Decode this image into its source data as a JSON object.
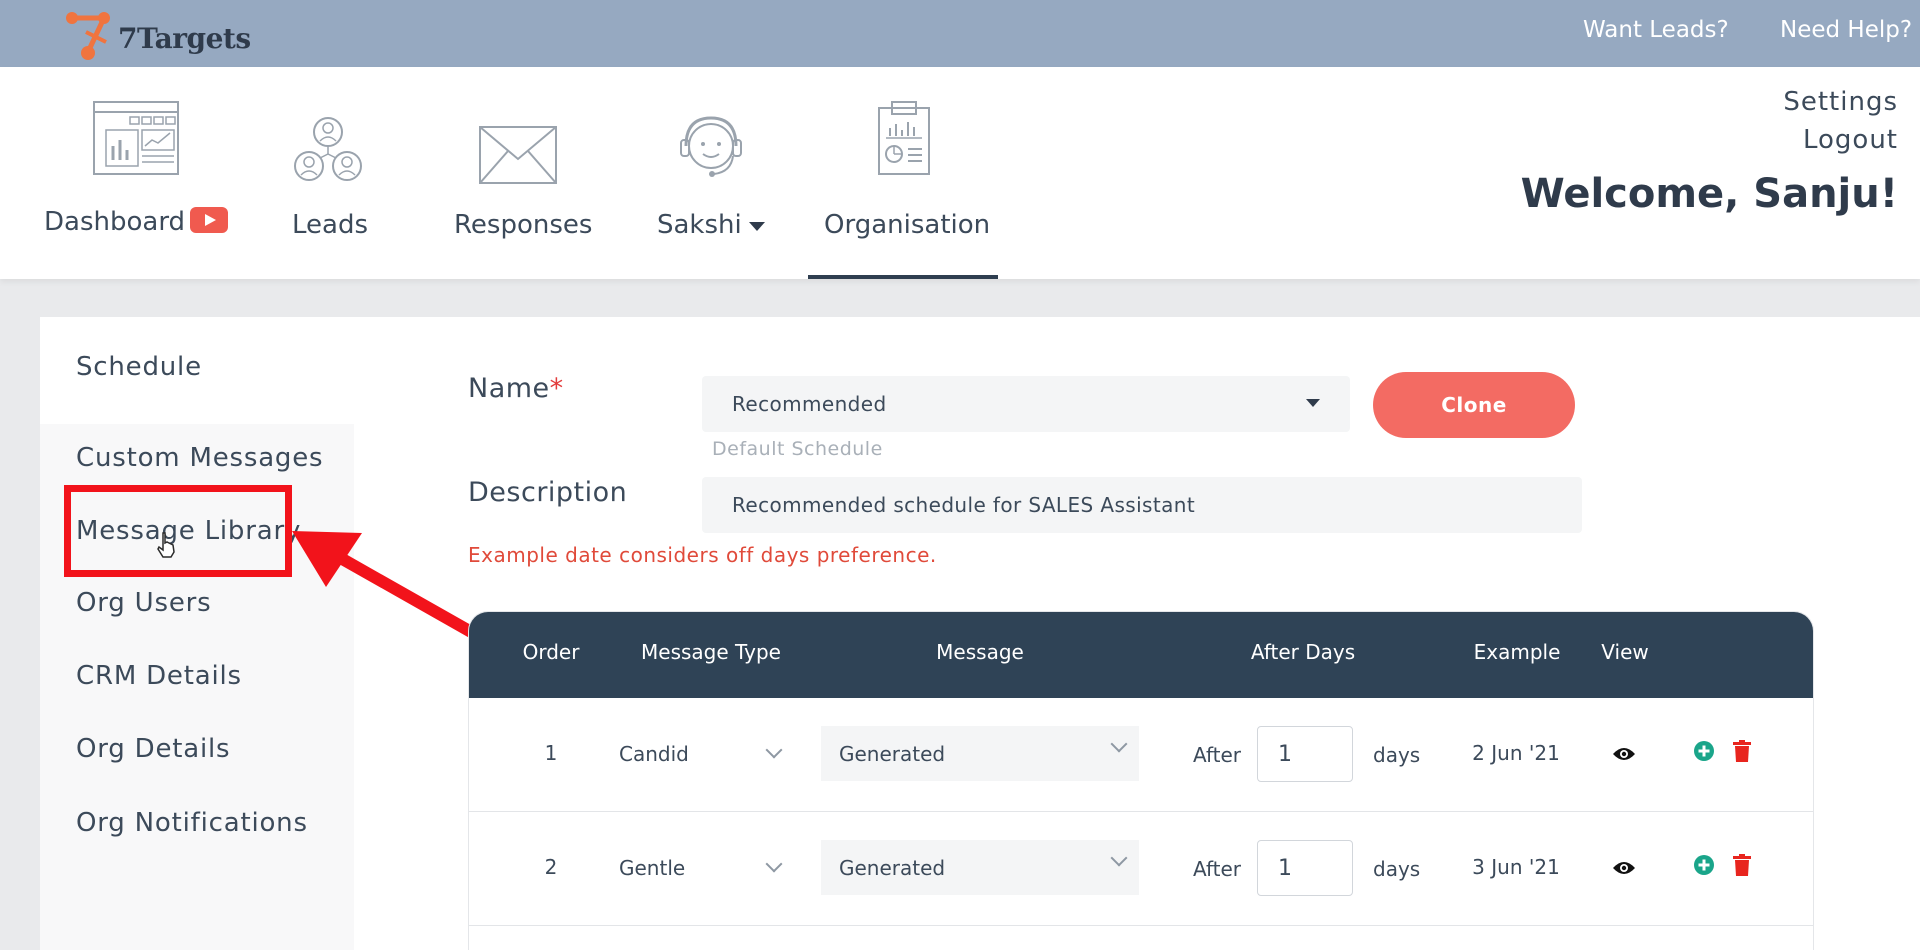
{
  "brand": {
    "name": "7Targets"
  },
  "topbar": {
    "want_leads": "Want Leads?",
    "need_help": "Need Help?"
  },
  "nav": {
    "items": [
      {
        "label": "Dashboard",
        "icon": "dashboard-icon"
      },
      {
        "label": "Leads",
        "icon": "leads-icon"
      },
      {
        "label": "Responses",
        "icon": "envelope-icon"
      },
      {
        "label": "Sakshi",
        "icon": "headset-assistant-icon"
      },
      {
        "label": "Organisation",
        "icon": "clipboard-report-icon"
      }
    ],
    "active": "Organisation"
  },
  "header": {
    "settings": "Settings",
    "logout": "Logout",
    "welcome": "Welcome, Sanju!"
  },
  "sidebar": {
    "items": [
      {
        "label": "Schedule"
      },
      {
        "label": "Custom Messages"
      },
      {
        "label": "Message Library"
      },
      {
        "label": "Org Users"
      },
      {
        "label": "CRM Details"
      },
      {
        "label": "Org Details"
      },
      {
        "label": "Org Notifications"
      }
    ]
  },
  "form": {
    "name_label": "Name",
    "required_mark": "*",
    "name_value": "Recommended",
    "name_hint": "Default Schedule",
    "clone_label": "Clone",
    "description_label": "Description",
    "description_value": "Recommended schedule for SALES Assistant",
    "notice": "Example date considers off days preference."
  },
  "table": {
    "headers": {
      "order": "Order",
      "message_type": "Message Type",
      "message": "Message",
      "after_days": "After Days",
      "example": "Example",
      "view": "View"
    },
    "after_label": "After",
    "days_label": "days",
    "rows": [
      {
        "order": "1",
        "type": "Candid",
        "message": "Generated",
        "days": "1",
        "example": "2 Jun '21"
      },
      {
        "order": "2",
        "type": "Gentle",
        "message": "Generated",
        "days": "1",
        "example": "3 Jun '21"
      }
    ]
  },
  "colors": {
    "topbar": "#96a9c1",
    "table_header": "#2f4356",
    "clone_button": "#f36b63",
    "notice_text": "#e04a3a",
    "add_icon": "#1aa58a",
    "delete_icon": "#e8251e",
    "annotation": "#f2131b"
  }
}
